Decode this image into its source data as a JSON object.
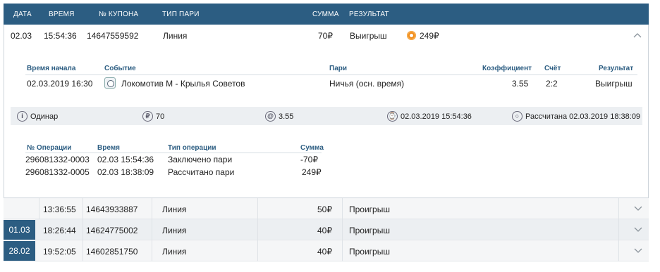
{
  "header": {
    "date": "ДАТА",
    "time": "ВРЕМЯ",
    "coupon": "№ КУПОНА",
    "bet_type": "ТИП ПАРИ",
    "amount": "СУММА",
    "result": "РЕЗУЛЬТАТ"
  },
  "expanded_bet": {
    "date": "02.03",
    "time": "15:54:36",
    "coupon": "14647559592",
    "bet_type": "Линия",
    "amount": "70₽",
    "result": "Выигрыш",
    "payout": "249₽",
    "details": {
      "headers": {
        "start_time": "Время начала",
        "event": "Событие",
        "bet": "Пари",
        "coef": "Коэффициент",
        "score": "Счёт",
        "result": "Результат"
      },
      "row": {
        "start_time": "02.03.2019 16:30",
        "event": "Локомотив М - Крылья Советов",
        "bet": "Ничья (осн. время)",
        "coef": "3.55",
        "score": "2:2",
        "result": "Выигрыш"
      }
    },
    "info_bar": {
      "kind": "Одинар",
      "stake": "70",
      "coef": "3.55",
      "placed": "02.03.2019 15:54:36",
      "settled": "Рассчитана 02.03.2019 18:38:09"
    },
    "operations": {
      "headers": {
        "op_no": "№ Операции",
        "time": "Время",
        "type": "Тип операции",
        "sum": "Сумма"
      },
      "rows": [
        {
          "op_no": "296081332-0003",
          "time": "02.03 15:54:36",
          "type": "Заключено пари",
          "sum": "-70₽"
        },
        {
          "op_no": "296081332-0005",
          "time": "02.03 18:38:09",
          "type": "Рассчитано пари",
          "sum": "249₽"
        }
      ]
    }
  },
  "bets": [
    {
      "date": "",
      "time": "13:36:55",
      "coupon": "14643933887",
      "bet_type": "Линия",
      "amount": "50₽",
      "result": "Проигрыш"
    },
    {
      "date": "01.03",
      "time": "18:26:44",
      "coupon": "14624775002",
      "bet_type": "Линия",
      "amount": "40₽",
      "result": "Проигрыш"
    },
    {
      "date": "28.02",
      "time": "19:52:05",
      "coupon": "14602851750",
      "bet_type": "Линия",
      "amount": "40₽",
      "result": "Проигрыш"
    }
  ],
  "colors": {
    "header_bg": "#2c5d82",
    "accent": "#f28c1a"
  }
}
